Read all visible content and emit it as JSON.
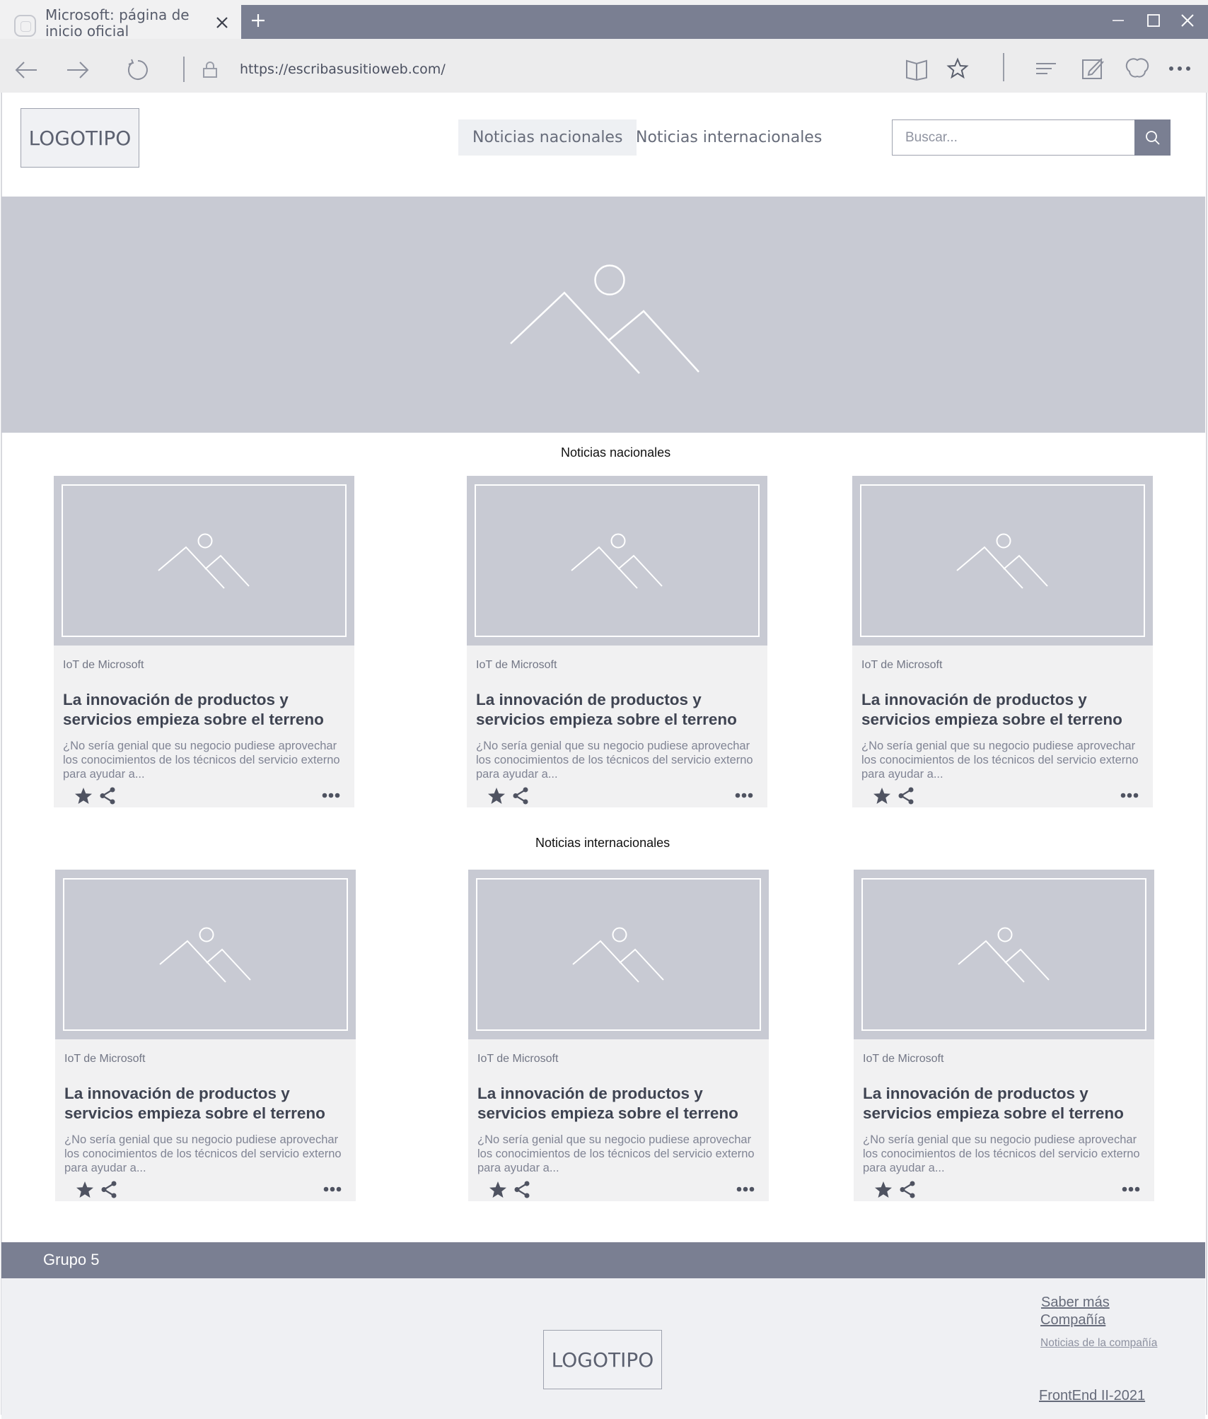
{
  "browser": {
    "tab_title": "Microsoft: página de inicio oficial",
    "url": "https://escribasusitioweb.com/",
    "icons": [
      "back-icon",
      "forward-icon",
      "refresh-icon",
      "lock-icon",
      "reading-view-icon",
      "favorite-star-icon",
      "hub-icon",
      "web-note-icon",
      "share-icon",
      "more-icon"
    ]
  },
  "header": {
    "logo": "LOGOTIPO",
    "nav": [
      {
        "label": "Noticias nacionales",
        "active": true
      },
      {
        "label": "Noticias internacionales",
        "active": false
      }
    ],
    "search_placeholder": "Buscar..."
  },
  "sections": [
    {
      "title": "Noticias nacionales",
      "cards": [
        {
          "kicker": "IoT de Microsoft",
          "headline": "La innovación de productos y servicios empieza sobre el terreno",
          "excerpt": "¿No sería genial que su negocio pudiese aprovechar los conocimientos de los técnicos del servicio externo para ayudar a..."
        },
        {
          "kicker": "IoT de Microsoft",
          "headline": "La innovación de productos y servicios empieza sobre el terreno",
          "excerpt": "¿No sería genial que su negocio pudiese aprovechar los conocimientos de los técnicos del servicio externo para ayudar a..."
        },
        {
          "kicker": "IoT de Microsoft",
          "headline": "La innovación de productos y servicios empieza sobre el terreno",
          "excerpt": "¿No sería genial que su negocio pudiese aprovechar los conocimientos de los técnicos del servicio externo para ayudar a..."
        }
      ]
    },
    {
      "title": "Noticias internacionales",
      "cards": [
        {
          "kicker": "IoT de Microsoft",
          "headline": "La innovación de productos y servicios empieza sobre el terreno",
          "excerpt": "¿No sería genial que su negocio pudiese aprovechar los conocimientos de los técnicos del servicio externo para ayudar a..."
        },
        {
          "kicker": "IoT de Microsoft",
          "headline": "La innovación de productos y servicios empieza sobre el terreno",
          "excerpt": "¿No sería genial que su negocio pudiese aprovechar los conocimientos de los técnicos del servicio externo para ayudar a..."
        },
        {
          "kicker": "IoT de Microsoft",
          "headline": "La innovación de productos y servicios empieza sobre el terreno",
          "excerpt": "¿No sería genial que su negocio pudiese aprovechar los conocimientos de los técnicos del servicio externo para ayudar a..."
        }
      ]
    }
  ],
  "footer": {
    "group_label": "Grupo 5",
    "logo": "LOGOTIPO",
    "links": {
      "learn_more": "Saber más",
      "company": "Compañía",
      "company_news": "Noticias de la compañía",
      "course": "FrontEnd II-2021"
    }
  },
  "colors": {
    "accent": "#7a7f92",
    "placeholder_fill": "#c8cad3",
    "card_bg": "#f1f1f2",
    "footer_bg": "#eff0f3"
  }
}
